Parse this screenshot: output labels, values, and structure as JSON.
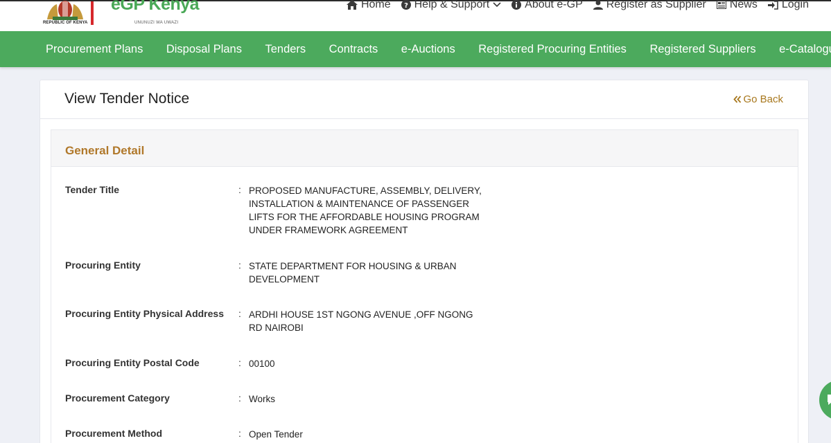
{
  "header": {
    "seal_caption": "REPUBLIC OF KENYA",
    "brand": "eGP Kenya",
    "tagline": "UNUNUZI WA UWAZI",
    "topnav": [
      {
        "label": "Home",
        "icon": "home-icon"
      },
      {
        "label": "Help & Support",
        "icon": "question-circle-icon"
      },
      {
        "label": "About e-GP",
        "icon": "info-circle-icon"
      },
      {
        "label": "Register as Supplier",
        "icon": "user-icon"
      },
      {
        "label": "News",
        "icon": "newspaper-icon"
      },
      {
        "label": "Login",
        "icon": "sign-in-icon"
      }
    ]
  },
  "menu": [
    "Procurement Plans",
    "Disposal Plans",
    "Tenders",
    "Contracts",
    "e-Auctions",
    "Registered Procuring Entities",
    "Registered Suppliers",
    "e-Catalogue"
  ],
  "page": {
    "title": "View Tender Notice",
    "go_back": "Go Back"
  },
  "general_detail": {
    "title": "General Detail",
    "colon": ":",
    "rows": [
      {
        "label": "Tender Title",
        "value": "PROPOSED MANUFACTURE, ASSEMBLY, DELIVERY, INSTALLATION & MAINTENANCE OF PASSENGER LIFTS FOR THE AFFORDABLE HOUSING PROGRAM UNDER FRAMEWORK AGREEMENT"
      },
      {
        "label": "Procuring Entity",
        "value": "STATE DEPARTMENT FOR HOUSING & URBAN DEVELOPMENT"
      },
      {
        "label": "Procuring Entity Physical Address",
        "value": "ARDHI HOUSE 1ST NGONG AVENUE ,OFF NGONG RD NAIROBI"
      },
      {
        "label": "Procuring Entity Postal Code",
        "value": "00100"
      },
      {
        "label": "Procurement Category",
        "value": "Works"
      },
      {
        "label": "Procurement Method",
        "value": "Open Tender"
      }
    ]
  },
  "colors": {
    "brand_green": "#4caa5d",
    "accent_gold": "#b0782a",
    "link_gold": "#a8781e"
  }
}
